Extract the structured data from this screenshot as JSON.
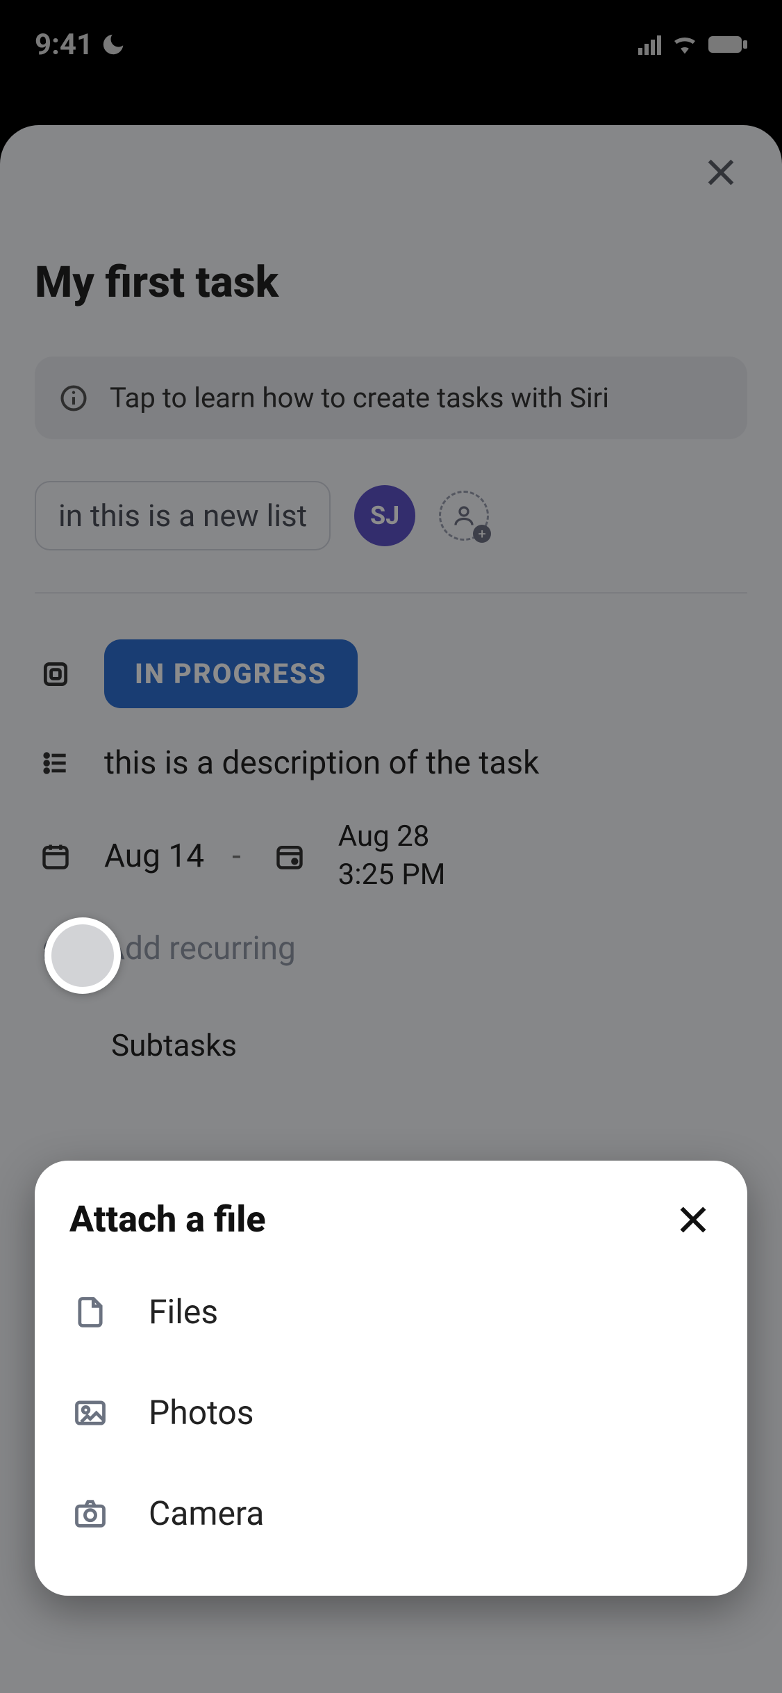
{
  "status_bar": {
    "time": "9:41"
  },
  "card": {
    "title": "My first task",
    "siri_banner": "Tap to learn how to create tasks with Siri",
    "list_chip_prefix": "in ",
    "list_chip_name": "this is a new list",
    "avatar_initials": "SJ",
    "status_label": "IN PROGRESS",
    "description": "this is a description of the task",
    "start_date": "Aug 14",
    "end_date": "Aug 28",
    "end_time": "3:25 PM",
    "recurring_placeholder": "Add recurring",
    "subtasks_label": "Subtasks"
  },
  "sheet": {
    "title": "Attach a file",
    "items": [
      {
        "label": "Files"
      },
      {
        "label": "Photos"
      },
      {
        "label": "Camera"
      }
    ]
  }
}
